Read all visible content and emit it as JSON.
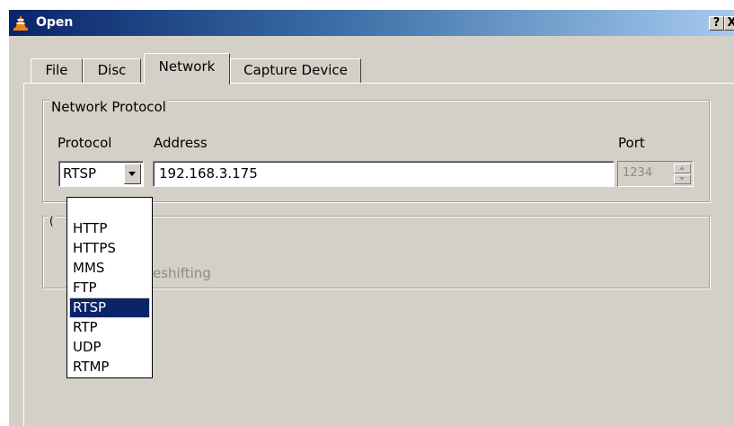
{
  "window": {
    "title": "Open",
    "help_button": "?",
    "close_button": "X"
  },
  "tabs": [
    {
      "label": "File",
      "active": false
    },
    {
      "label": "Disc",
      "active": false
    },
    {
      "label": "Network",
      "active": true
    },
    {
      "label": "Capture Device",
      "active": false
    }
  ],
  "network_protocol": {
    "group_title": "Network Protocol",
    "protocol_label": "Protocol",
    "address_label": "Address",
    "port_label": "Port",
    "protocol_value": "RTSP",
    "address_value": "192.168.3.175",
    "port_value": "1234"
  },
  "options": {
    "group_title_fragment": "(",
    "timeshift_fragment": "eshifting"
  },
  "protocol_dropdown": {
    "options": [
      "HTTP",
      "HTTPS",
      "MMS",
      "FTP",
      "RTSP",
      "RTP",
      "UDP",
      "RTMP"
    ],
    "selected": "RTSP"
  },
  "colors": {
    "titlebar_start": "#0a246a",
    "titlebar_end": "#a6caf0",
    "dialog_background": "#d4d0c8",
    "selection_background": "#0a246a",
    "app_icon_orange": "#f08010"
  },
  "icons": {
    "app_icon": "vlc-cone-icon",
    "combo_arrow": "chevron-down-icon",
    "spin_up": "spin-up-icon",
    "spin_down": "spin-down-icon"
  }
}
